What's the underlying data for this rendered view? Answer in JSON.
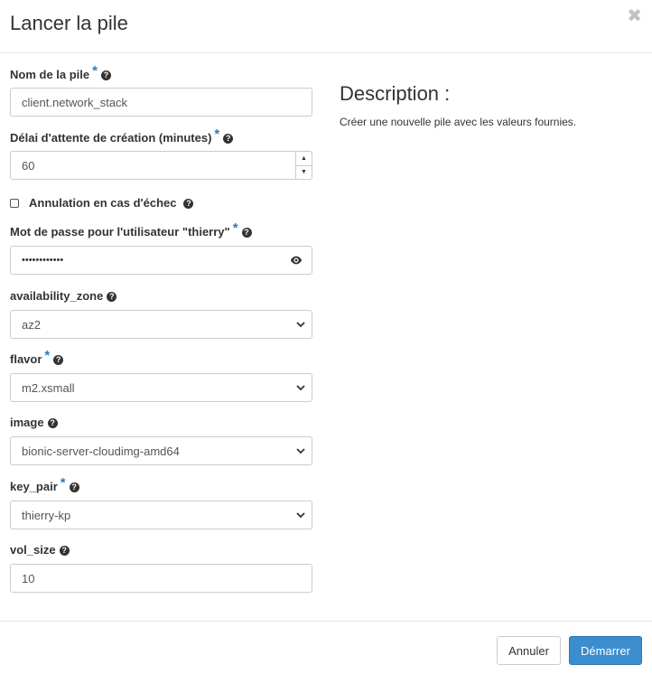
{
  "dialog": {
    "title": "Lancer la pile",
    "close_icon": "close-icon"
  },
  "form": {
    "stack_name": {
      "label": "Nom de la pile",
      "required": "*",
      "value": "client.network_stack"
    },
    "timeout": {
      "label": "Délai d'attente de création (minutes)",
      "required": "*",
      "value": "60"
    },
    "rollback": {
      "label": "Annulation en cas d'échec",
      "checked": false
    },
    "password": {
      "label": "Mot de passe pour l'utilisateur \"thierry\"",
      "required": "*",
      "value": "••••••••••••"
    },
    "availability_zone": {
      "label": "availability_zone",
      "value": "az2"
    },
    "flavor": {
      "label": "flavor",
      "required": "*",
      "value": "m2.xsmall"
    },
    "image": {
      "label": "image",
      "value": "bionic-server-cloudimg-amd64"
    },
    "key_pair": {
      "label": "key_pair",
      "required": "*",
      "value": "thierry-kp"
    },
    "vol_size": {
      "label": "vol_size",
      "value": "10"
    },
    "help_glyph": "?"
  },
  "description": {
    "title": "Description :",
    "text": "Créer une nouvelle pile avec les valeurs fournies."
  },
  "footer": {
    "cancel_label": "Annuler",
    "launch_label": "Démarrer"
  },
  "colors": {
    "accent": "#337ab7",
    "primary_button": "#3c8dce"
  }
}
